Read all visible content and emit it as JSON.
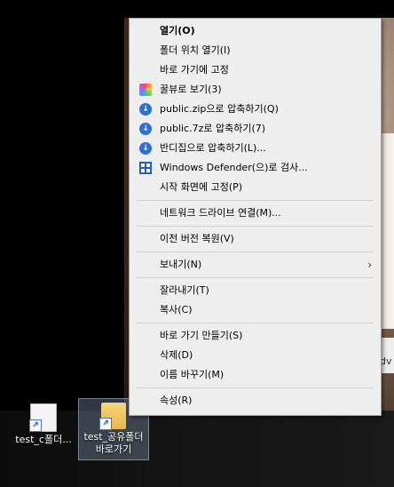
{
  "desktop": {
    "icons": [
      {
        "label": "test_c폴더..."
      },
      {
        "label_line1": "test_공유폴더",
        "label_line2": "바로가기"
      }
    ]
  },
  "context_menu": {
    "open": "열기(O)",
    "open_folder_location": "폴더 위치 열기(I)",
    "pin_quick_access": "바로 가기에 고정",
    "honeyview": "꿀뷰로 보기(3)",
    "zip": "public.zip으로 압축하기(Q)",
    "sevenz": "public.7z로 압축하기(7)",
    "bandizip": "반디집으로 압축하기(L)...",
    "defender": "Windows Defender(으)로 검사...",
    "pin_start": "시작 화면에 고정(P)",
    "map_network": "네트워크 드라이브 연결(M)...",
    "restore_versions": "이전 버전 복원(V)",
    "send_to": "보내기(N)",
    "cut": "잘라내기(T)",
    "copy": "복사(C)",
    "create_shortcut": "바로 가기 만들기(S)",
    "delete": "삭제(D)",
    "rename": "이름 바꾸기(M)",
    "properties": "속성(R)"
  },
  "background_text": {
    "dv": "dv"
  },
  "colors": {
    "menu_bg": "#eeeeee",
    "accent_blue": "#2c6fd6"
  }
}
